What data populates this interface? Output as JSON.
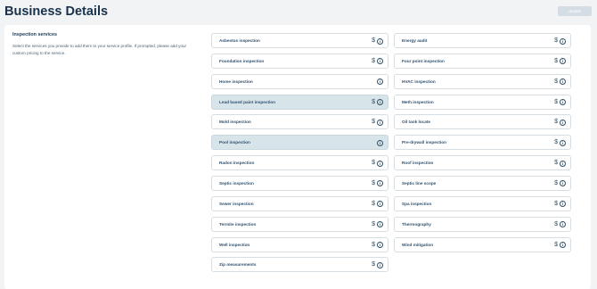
{
  "header": {
    "title": "Business Details",
    "update_label": "Update"
  },
  "section": {
    "title": "Inspection services",
    "description": "Select the services you provide to add them to your service profile. If prompted, please add your custom pricing to the service."
  },
  "icons": {
    "dollar": "$",
    "info": "i"
  },
  "services_left": [
    {
      "label": "Asbestos inspection",
      "pricing": true,
      "selected": false
    },
    {
      "label": "Foundation inspection",
      "pricing": true,
      "selected": false
    },
    {
      "label": "Home inspection",
      "pricing": false,
      "selected": false
    },
    {
      "label": "Lead based paint inspection",
      "pricing": true,
      "selected": true
    },
    {
      "label": "Mold inspection",
      "pricing": true,
      "selected": false
    },
    {
      "label": "Pool inspection",
      "pricing": false,
      "selected": true
    },
    {
      "label": "Radon inspection",
      "pricing": true,
      "selected": false
    },
    {
      "label": "Septic inspection",
      "pricing": true,
      "selected": false
    },
    {
      "label": "Sewer inspection",
      "pricing": true,
      "selected": false
    },
    {
      "label": "Termite inspection",
      "pricing": true,
      "selected": false
    },
    {
      "label": "Well inspection",
      "pricing": true,
      "selected": false
    },
    {
      "label": "Zip measurements",
      "pricing": true,
      "selected": false
    }
  ],
  "services_right": [
    {
      "label": "Energy audit",
      "pricing": true,
      "selected": false
    },
    {
      "label": "Four point inspection",
      "pricing": true,
      "selected": false
    },
    {
      "label": "HVAC inspection",
      "pricing": true,
      "selected": false
    },
    {
      "label": "Meth inspection",
      "pricing": true,
      "selected": false
    },
    {
      "label": "Oil tank locate",
      "pricing": true,
      "selected": false
    },
    {
      "label": "Pre-drywall inspection",
      "pricing": true,
      "selected": false
    },
    {
      "label": "Roof inspection",
      "pricing": true,
      "selected": false
    },
    {
      "label": "Septic line scope",
      "pricing": true,
      "selected": false
    },
    {
      "label": "Spa inspection",
      "pricing": true,
      "selected": false
    },
    {
      "label": "Thermography",
      "pricing": true,
      "selected": false
    },
    {
      "label": "Wind mitigation",
      "pricing": true,
      "selected": false
    }
  ]
}
